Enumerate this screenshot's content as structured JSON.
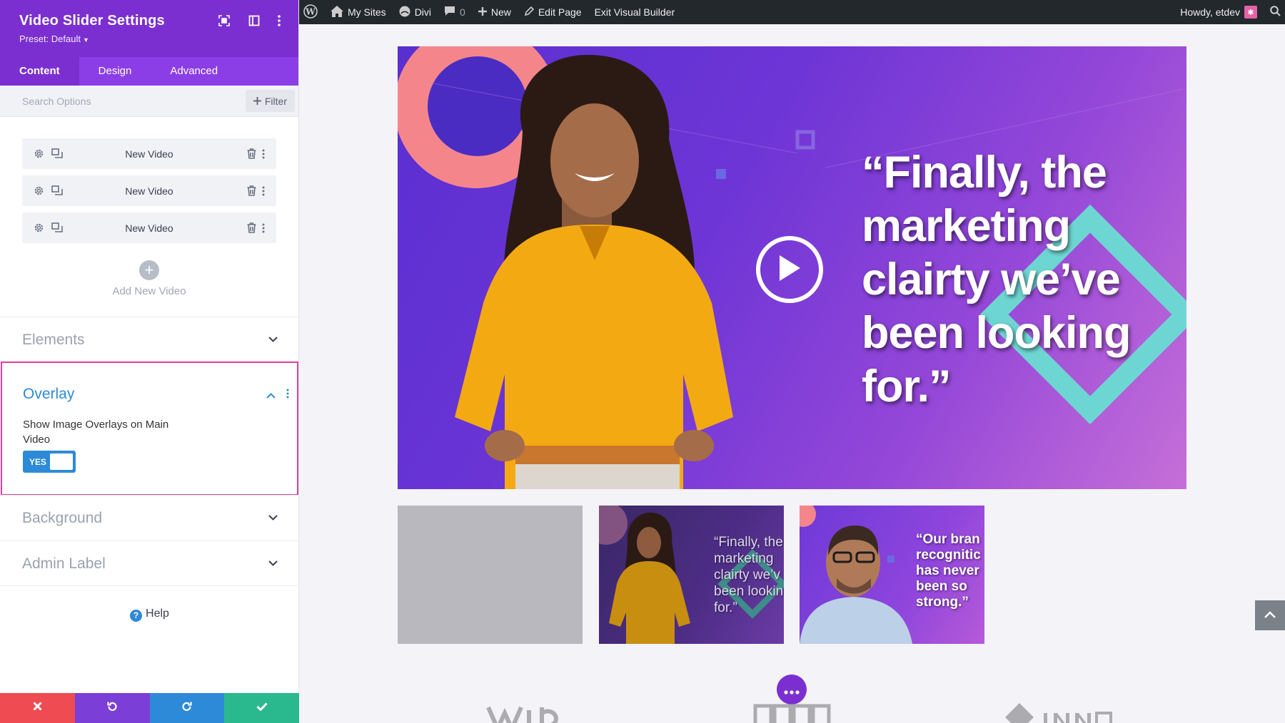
{
  "panel": {
    "title": "Video Slider Settings",
    "preset": "Preset: Default",
    "tabs": [
      {
        "label": "Content",
        "active": true
      },
      {
        "label": "Design",
        "active": false
      },
      {
        "label": "Advanced",
        "active": false
      }
    ],
    "search": {
      "placeholder": "Search Options",
      "filter_label": "Filter"
    },
    "videos": [
      {
        "label": "New Video"
      },
      {
        "label": "New Video"
      },
      {
        "label": "New Video"
      }
    ],
    "add_video_label": "Add New Video",
    "sections": {
      "elements": "Elements",
      "overlay": "Overlay",
      "background": "Background",
      "admin_label": "Admin Label"
    },
    "overlay": {
      "option_label": "Show Image Overlays on Main Video",
      "toggle_value": "YES"
    },
    "help_label": "Help"
  },
  "admin_bar": {
    "my_sites": "My Sites",
    "divi": "Divi",
    "comments_count": "0",
    "new": "New",
    "edit_page": "Edit Page",
    "exit_builder": "Exit Visual Builder",
    "howdy": "Howdy, etdev"
  },
  "slider": {
    "main_quote": "“Finally, the\nmarketing\nclairty we’ve\nbeen looking\nfor.”",
    "thumb2_quote": "“Finally, the\nmarketing\nclairty we’v\nbeen lookin\nfor.”",
    "thumb3_quote": "“Our bran\nrecognitic\nhas never\nbeen so\nstrong.”"
  },
  "colors": {
    "accent_purple": "#7b2fd0",
    "tab_bar": "#8c3ee6",
    "highlight_pink": "#e33f9a",
    "link_blue": "#2d8ad8",
    "cancel_red": "#ef4b52",
    "undo_purple": "#7b3ed6",
    "redo_blue": "#2d8ad8",
    "save_green": "#2ab98f"
  },
  "icons": [
    "wordpress-icon",
    "my-sites-icon",
    "divi-icon",
    "comment-icon",
    "plus-icon",
    "pencil-icon",
    "search-icon",
    "gear-icon",
    "duplicate-icon",
    "trash-icon",
    "more-icon",
    "chevron-down-icon",
    "chevron-up-icon",
    "help-icon",
    "close-icon",
    "undo-icon",
    "redo-icon",
    "check-icon",
    "play-icon"
  ]
}
